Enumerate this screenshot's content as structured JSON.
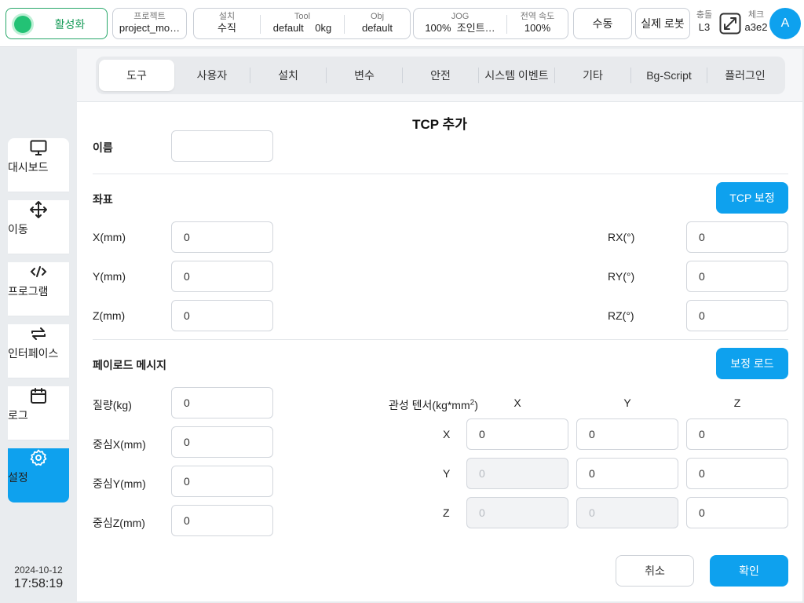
{
  "topbar": {
    "status_label": "활성화",
    "status_color": "#23c275",
    "project": {
      "title": "프로젝트",
      "value": "project_mo…"
    },
    "install": {
      "title": "설치",
      "value": "수직"
    },
    "tool": {
      "title": "Tool",
      "value": "default",
      "weight": "0kg"
    },
    "obj": {
      "title": "Obj",
      "value": "default"
    },
    "jog": {
      "title": "JOG",
      "percent": "100%",
      "mode": "조인트…"
    },
    "global_speed": {
      "title": "전역 속도",
      "value": "100%"
    },
    "manual": "수동",
    "real_robot": "실제 로봇",
    "collision": {
      "title": "충돌",
      "value": "L3"
    },
    "check": {
      "title": "체크",
      "value": "a3e2"
    },
    "avatar": "A",
    "accent_color": "#0ea1ee"
  },
  "sidebar": {
    "items": [
      {
        "label": "대시보드",
        "icon": "monitor-icon"
      },
      {
        "label": "이동",
        "icon": "move-icon"
      },
      {
        "label": "프로그램",
        "icon": "code-icon"
      },
      {
        "label": "인터페이스",
        "icon": "swap-icon"
      },
      {
        "label": "로그",
        "icon": "calendar-icon"
      },
      {
        "label": "설정",
        "icon": "gear-icon",
        "active": true
      }
    ],
    "date": "2024-10-12",
    "time": "17:58:19"
  },
  "tabs": [
    "도구",
    "사용자",
    "설치",
    "변수",
    "안전",
    "시스템 이벤트",
    "기타",
    "Bg-Script",
    "플러그인"
  ],
  "form": {
    "title": "TCP 추가",
    "name_label": "이름",
    "name_value": "",
    "coords_label": "좌표",
    "tcp_calib_button": "TCP 보정",
    "x_label": "X(mm)",
    "x_value": "0",
    "y_label": "Y(mm)",
    "y_value": "0",
    "z_label": "Z(mm)",
    "z_value": "0",
    "rx_label": "RX(°)",
    "rx_value": "0",
    "ry_label": "RY(°)",
    "ry_value": "0",
    "rz_label": "RZ(°)",
    "rz_value": "0",
    "payload_label": "페이로드 메시지",
    "calib_load_button": "보정 로드",
    "mass_label": "질량(kg)",
    "mass_value": "0",
    "cx_label": "중심X(mm)",
    "cx_value": "0",
    "cy_label": "중심Y(mm)",
    "cy_value": "0",
    "cz_label": "중심Z(mm)",
    "cz_value": "0",
    "inertia_label": "관성 텐서(kg*mm",
    "inertia_sup": "2",
    "inertia_close": ")",
    "col_x": "X",
    "col_y": "Y",
    "col_z": "Z",
    "row_x": "X",
    "row_y": "Y",
    "row_z": "Z",
    "ixx": "0",
    "ixy": "0",
    "ixz": "0",
    "iyx": "0",
    "iyy": "0",
    "iyz": "0",
    "izx": "0",
    "izy": "0",
    "izz": "0",
    "cancel_button": "취소",
    "confirm_button": "확인"
  }
}
